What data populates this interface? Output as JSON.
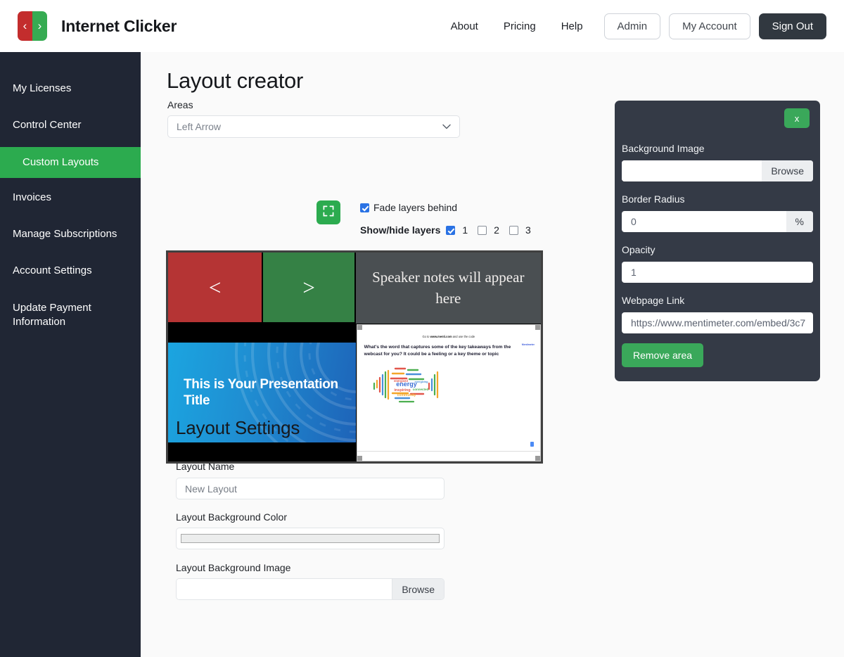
{
  "header": {
    "brand_title": "Internet Clicker",
    "logo_left_glyph": "‹",
    "logo_right_glyph": "›",
    "nav_links": [
      {
        "label": "About"
      },
      {
        "label": "Pricing"
      },
      {
        "label": "Help"
      }
    ],
    "admin_label": "Admin",
    "account_label": "My Account",
    "signout_label": "Sign Out"
  },
  "sidebar": {
    "items": [
      {
        "label": "My Licenses",
        "active": false
      },
      {
        "label": "Control Center",
        "active": false
      },
      {
        "label": "Custom Layouts",
        "active": true
      },
      {
        "label": "Invoices",
        "active": false
      },
      {
        "label": "Manage Subscriptions",
        "active": false
      },
      {
        "label": "Account Settings",
        "active": false
      },
      {
        "label": "Update Payment Information",
        "active": false
      }
    ],
    "active_color": "#2cab4f",
    "background_color": "#202634"
  },
  "main": {
    "page_title": "Layout creator",
    "areas_label": "Areas",
    "areas_selected": "Left Arrow",
    "chevron": "⌄",
    "fade_layers_label": "Fade layers behind",
    "fade_layers_checked": true,
    "show_hide_label": "Show/hide layers",
    "layers": [
      {
        "label": "1",
        "checked": true
      },
      {
        "label": "2",
        "checked": false
      },
      {
        "label": "3",
        "checked": false
      }
    ]
  },
  "canvas": {
    "left_arrow_glyph": "<",
    "right_arrow_glyph": ">",
    "left_arrow_color": "#b53434",
    "right_arrow_color": "#358145",
    "notes_text": "Speaker notes will appear here",
    "notes_bg": "#4a4f52",
    "slide_title": "This is Your Presentation Title",
    "embed": {
      "top_line_prefix": "Go to ",
      "top_line_url": "www.menti.com",
      "top_line_suffix": " and use the code",
      "question": "What's the word that captures some of the key takeaways from the webcast for you? It could be a feeling or a key theme or topic",
      "brand": "Mentimeter",
      "cloud_words": [
        "energy",
        "inspiring",
        "connected",
        "community",
        "energised",
        "togetherness",
        "happy",
        "energizing",
        "wellbeing"
      ]
    }
  },
  "layout_settings": {
    "section_title": "Layout Settings",
    "name_label": "Layout Name",
    "name_value": "New Layout",
    "bg_color_label": "Layout Background Color",
    "bg_color_value": "#eceded",
    "bg_image_label": "Layout Background Image",
    "bg_image_value": "",
    "browse_label": "Browse"
  },
  "panel": {
    "close_label": "x",
    "bg_image_label": "Background Image",
    "bg_image_value": "",
    "browse_label": "Browse",
    "border_radius_label": "Border Radius",
    "border_radius_value": "0",
    "border_radius_unit": "%",
    "opacity_label": "Opacity",
    "opacity_value": "1",
    "webpage_link_label": "Webpage Link",
    "webpage_link_value": "https://www.mentimeter.com/embed/3c7",
    "remove_label": "Remove area",
    "accent_color": "#3aa85a",
    "background_color": "#343a46"
  }
}
